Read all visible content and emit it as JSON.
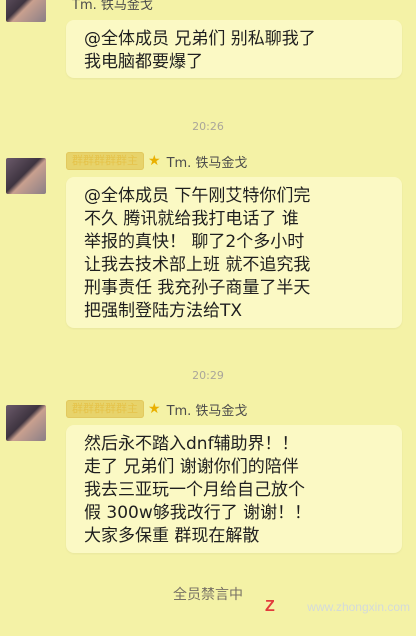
{
  "messages": [
    {
      "lines": [
        "@全体成员  兄弟们 别私聊我了",
        "我电脑都要爆了"
      ],
      "badge": "",
      "crown": "",
      "name": "Tm. 铁马金戈"
    },
    {
      "time": "20:26",
      "badge": "群群群群群主",
      "crown": "★",
      "name": "Tm. 铁马金戈",
      "lines": [
        "@全体成员   下午刚艾特你们完",
        "不久 腾讯就给我打电话了  谁",
        "举报的真快！ 聊了2个多小时",
        "让我去技术部上班 就不追究我",
        "刑事责任  我充孙子商量了半天",
        " 把强制登陆方法给TX"
      ]
    },
    {
      "time": "20:29",
      "badge": "群群群群群主",
      "crown": "★",
      "name": "Tm. 铁马金戈",
      "lines": [
        "然后永不踏入dnf辅助界！！",
        "走了 兄弟们  谢谢你们的陪伴",
        "我去三亚玩一个月给自己放个",
        "假    300w够我改行了 谢谢！！",
        " 大家多保重 群现在解散"
      ]
    }
  ],
  "footer": "全员禁言中",
  "watermark": "www.zhongxin.com",
  "colors": {
    "background": "#f4f2a6",
    "badge": "#e7d36b",
    "crown": "#e9b000"
  }
}
